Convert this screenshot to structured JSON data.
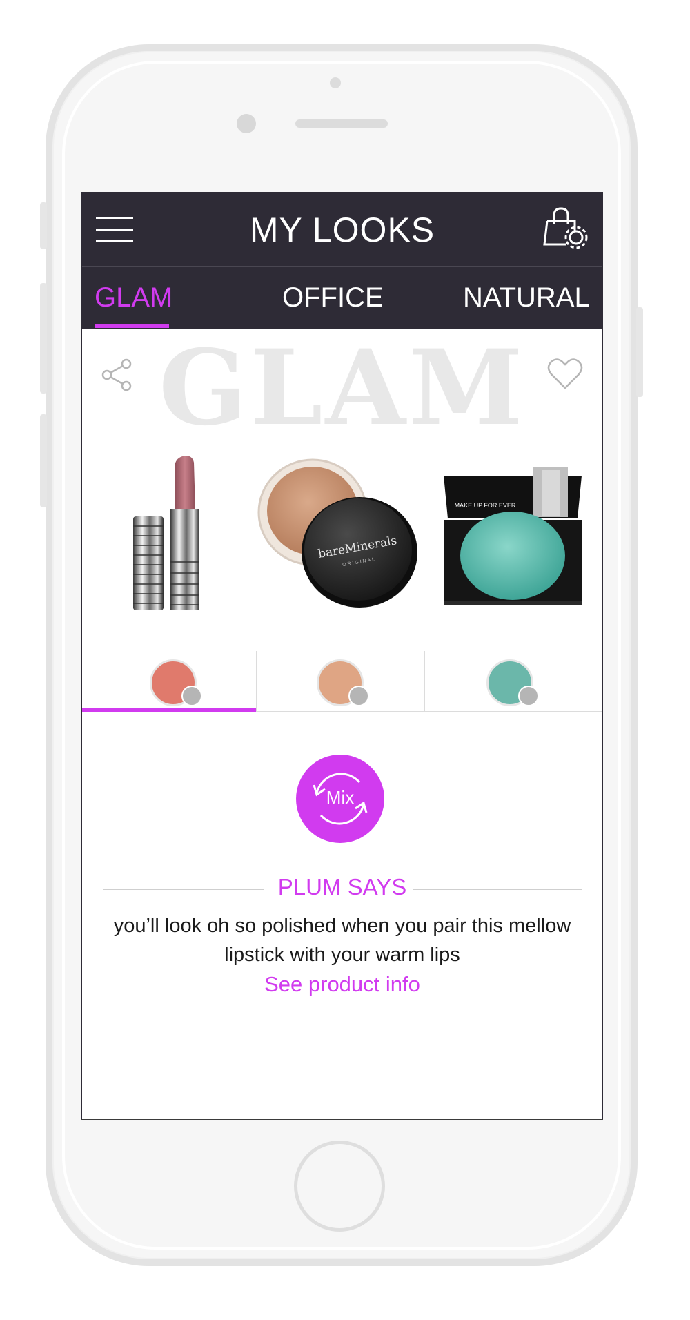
{
  "header": {
    "title": "MY LOOKS"
  },
  "tabs": [
    {
      "label": "GLAM",
      "active": true
    },
    {
      "label": "OFFICE",
      "active": false
    },
    {
      "label": "NATURAL",
      "active": false
    }
  ],
  "look": {
    "watermark": "GLAM",
    "products": [
      {
        "name": "lipstick",
        "brand_text": ""
      },
      {
        "name": "powder",
        "brand_text": "bareMinerals",
        "sub_text": "ORIGINAL"
      },
      {
        "name": "eyeshadow",
        "brand_text": "MAKE UP FOR EVER"
      }
    ],
    "swatches": [
      {
        "color": "#e07a6c",
        "selected": true
      },
      {
        "color": "#dfa584",
        "selected": false
      },
      {
        "color": "#6bb7aa",
        "selected": false
      }
    ]
  },
  "mix_button": {
    "label": "Mix"
  },
  "plum_says": {
    "title": "PLUM SAYS",
    "message": "you’ll look oh so polished when you pair this mellow lipstick with your warm lips",
    "link": "See product info"
  },
  "colors": {
    "accent": "#d13bef",
    "header_bg": "#2e2b36"
  }
}
